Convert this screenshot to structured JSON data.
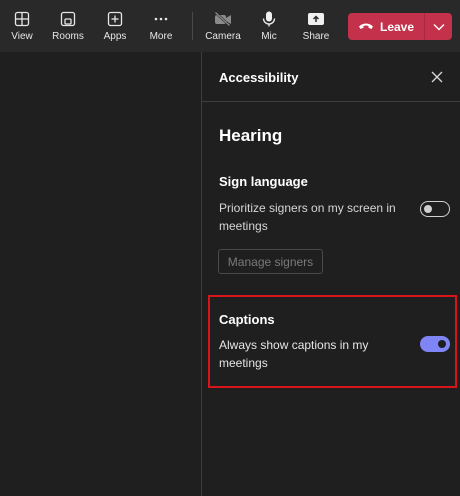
{
  "toolbar": {
    "view_label": "View",
    "rooms_label": "Rooms",
    "apps_label": "Apps",
    "more_label": "More",
    "camera_label": "Camera",
    "mic_label": "Mic",
    "share_label": "Share",
    "leave_label": "Leave"
  },
  "panel": {
    "title": "Accessibility",
    "section_heading": "Hearing",
    "sign_language": {
      "heading": "Sign language",
      "description": "Prioritize signers on my screen in meetings",
      "toggle_state": "off",
      "manage_button": "Manage signers"
    },
    "captions": {
      "heading": "Captions",
      "description": "Always show captions in my meetings",
      "toggle_state": "on"
    }
  },
  "colors": {
    "accent": "#7f85f5",
    "leave": "#c4314b",
    "highlight_border": "#d9141a"
  }
}
